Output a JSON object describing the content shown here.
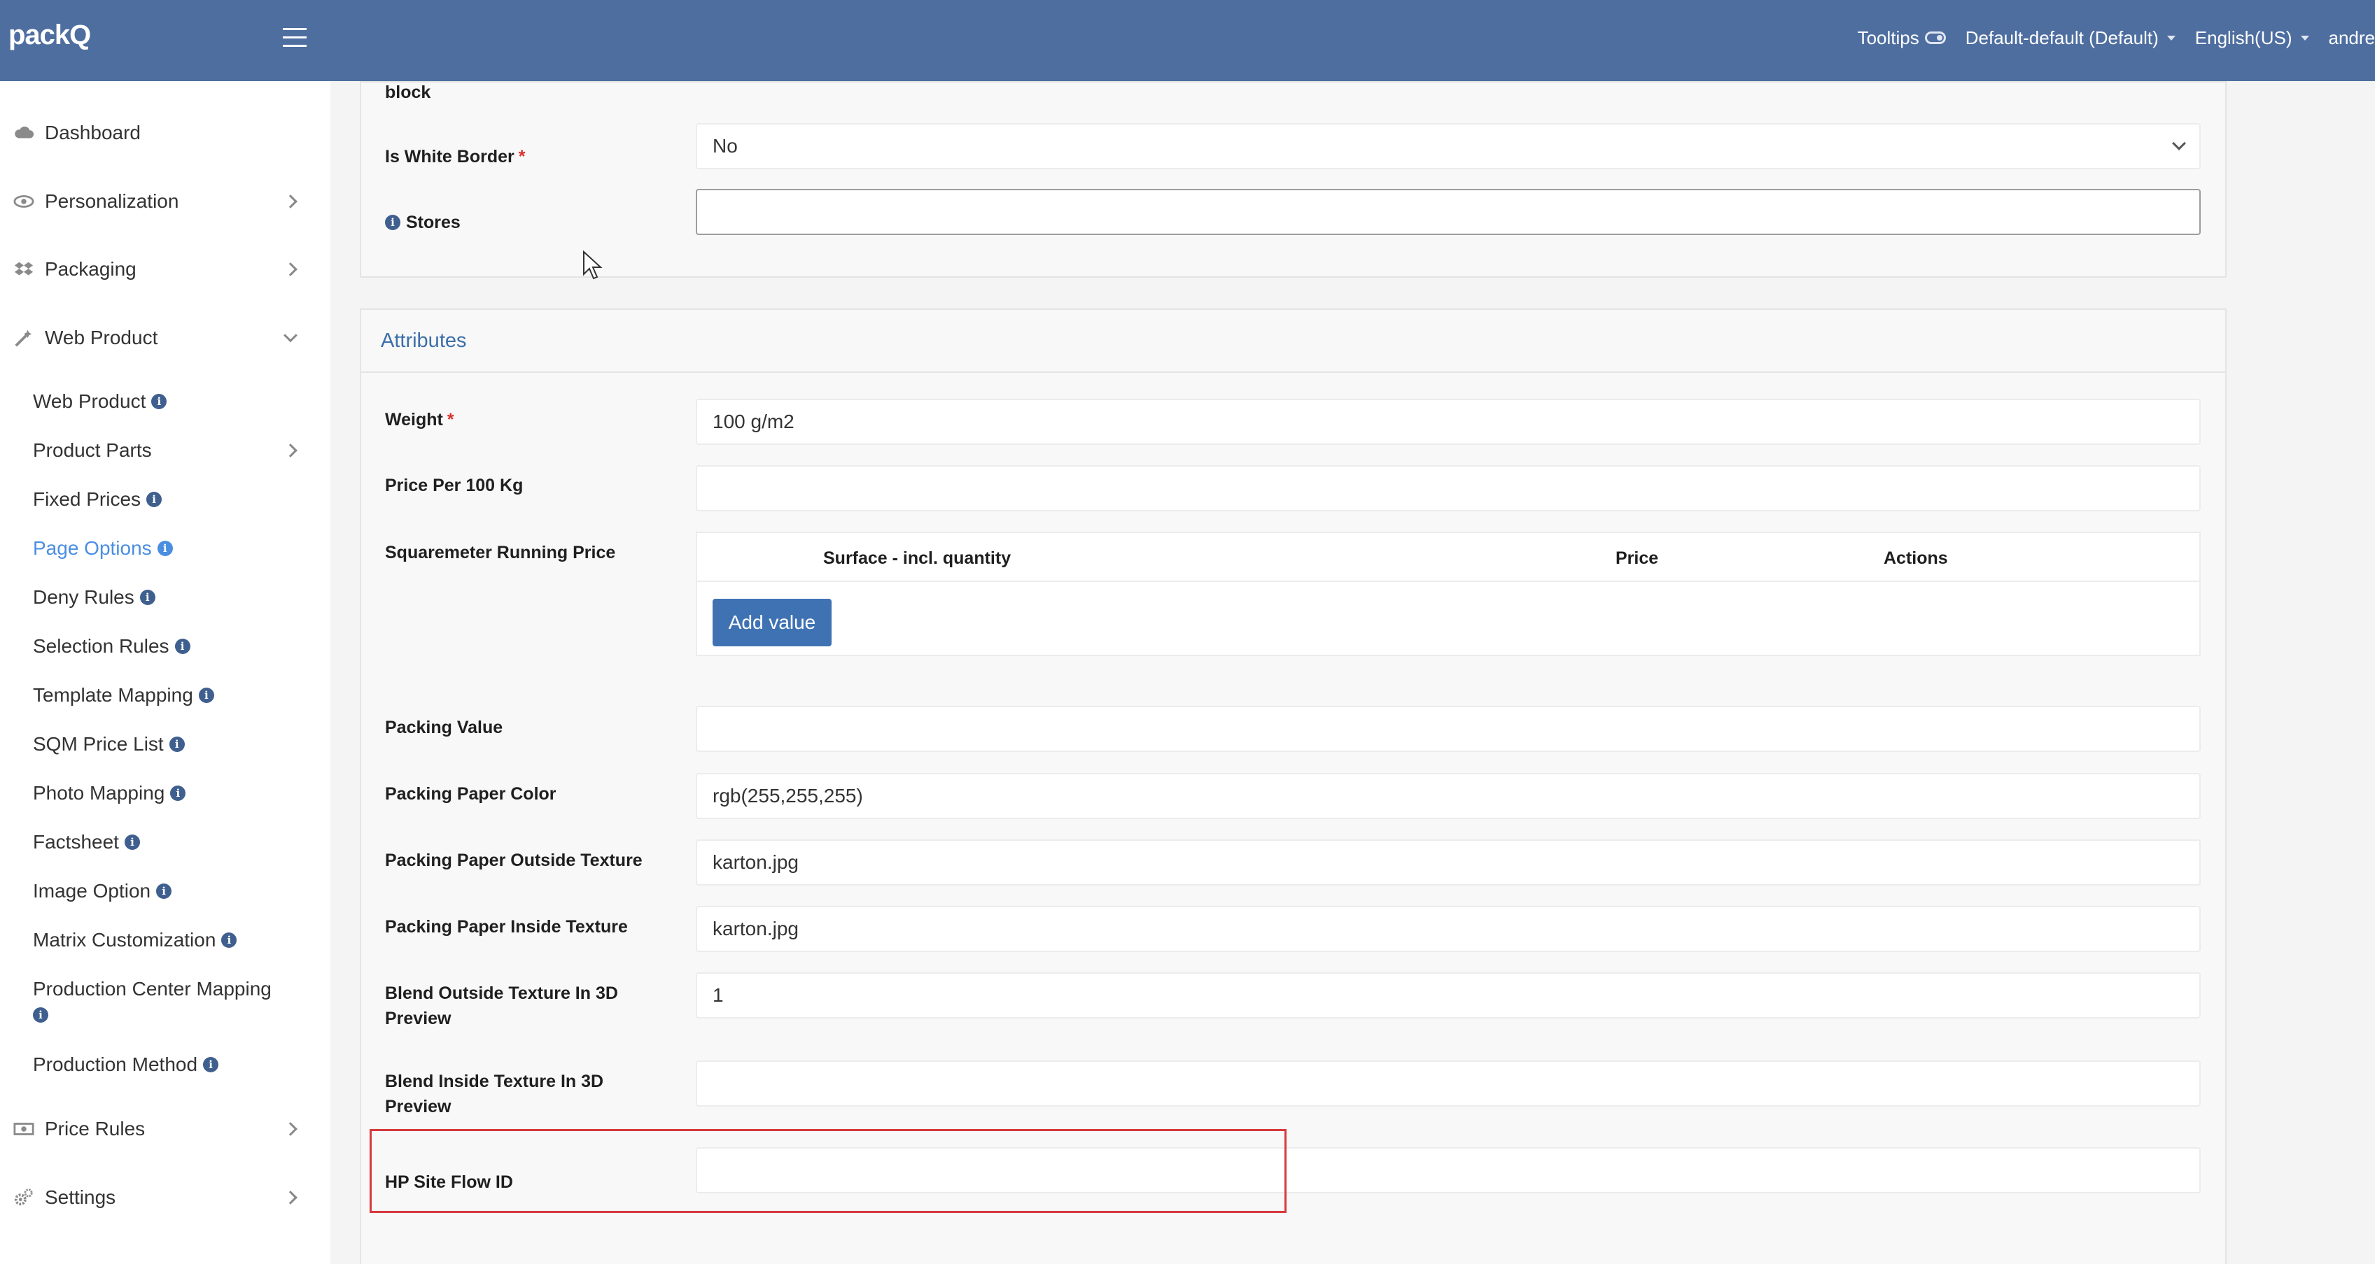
{
  "topbar": {
    "logo": "packQ",
    "tooltips_label": "Tooltips",
    "store_select": "Default-default (Default)",
    "language_select": "English(US)",
    "user": "andre"
  },
  "sidebar": {
    "dashboard": "Dashboard",
    "personalization": "Personalization",
    "packaging": "Packaging",
    "web_product": "Web Product",
    "subitems": [
      "Web Product",
      "Product Parts",
      "Fixed Prices",
      "Page Options",
      "Deny Rules",
      "Selection Rules",
      "Template Mapping",
      "SQM Price List",
      "Photo Mapping",
      "Factsheet",
      "Image Option",
      "Matrix Customization",
      "Production Center Mapping",
      "Production Method"
    ],
    "price_rules": "Price Rules",
    "settings": "Settings"
  },
  "form": {
    "cut_label": "block",
    "is_white_border_label": "Is White Border",
    "is_white_border_value": "No",
    "stores_label": "Stores",
    "stores_value": "",
    "required_mark": "*",
    "info_mark": "i"
  },
  "attributes": {
    "title": "Attributes",
    "weight_label": "Weight",
    "weight_value": "100 g/m2",
    "price_per_100kg_label": "Price Per 100 Kg",
    "price_per_100kg_value": "",
    "sqm_running_price_label": "Squaremeter Running Price",
    "table_headers": [
      "Surface - incl. quantity",
      "Price",
      "Actions"
    ],
    "add_value_button": "Add value",
    "packing_value_label": "Packing Value",
    "packing_value_value": "",
    "packing_paper_color_label": "Packing Paper Color",
    "packing_paper_color_value": "rgb(255,255,255)",
    "outside_texture_label": "Packing Paper Outside Texture",
    "outside_texture_value": "karton.jpg",
    "inside_texture_label": "Packing Paper Inside Texture",
    "inside_texture_value": "karton.jpg",
    "blend_outside_label_1": "Blend Outside Texture In 3D",
    "blend_outside_label_2": "Preview",
    "blend_outside_value": "1",
    "blend_inside_label_1": "Blend Inside Texture In 3D",
    "blend_inside_label_2": "Preview",
    "blend_inside_value": "",
    "hp_site_flow_label": "HP Site Flow ID",
    "hp_site_flow_value": ""
  },
  "colors": {
    "topbar": "#4e6ea0",
    "accent": "#3f72b3",
    "active_link": "#4a8ee0",
    "required": "#d9302c",
    "highlight": "#d53a3e"
  }
}
